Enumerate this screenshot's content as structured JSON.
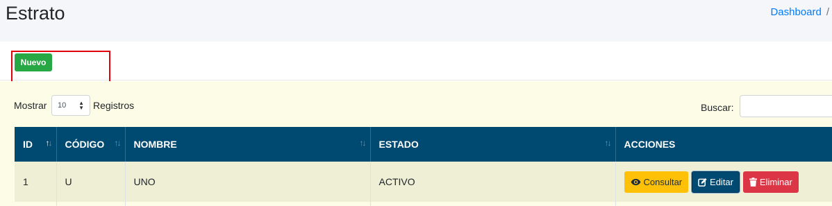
{
  "page": {
    "title": "Estrato"
  },
  "breadcrumb": {
    "home": "Dashboard",
    "separator": "/"
  },
  "toolbar": {
    "new_label": "Nuevo"
  },
  "length": {
    "prefix": "Mostrar",
    "value": "10",
    "suffix": "Registros"
  },
  "search": {
    "label": "Buscar:",
    "value": ""
  },
  "table": {
    "columns": [
      "ID",
      "CÓDIGO",
      "NOMBRE",
      "ESTADO",
      "ACCIONES"
    ],
    "rows": [
      {
        "id": "1",
        "codigo": "U",
        "nombre": "UNO",
        "estado": "ACTIVO"
      }
    ]
  },
  "actions": {
    "view": "Consultar",
    "edit": "Editar",
    "delete": "Eliminar"
  },
  "colors": {
    "header_bg": "#004a72",
    "new_button": "#28a745",
    "view_button": "#ffc107",
    "delete_button": "#dc3545",
    "highlight_border": "#e3000b"
  },
  "icons": {
    "view": "eye-icon",
    "edit": "edit-icon",
    "delete": "trash-icon"
  }
}
